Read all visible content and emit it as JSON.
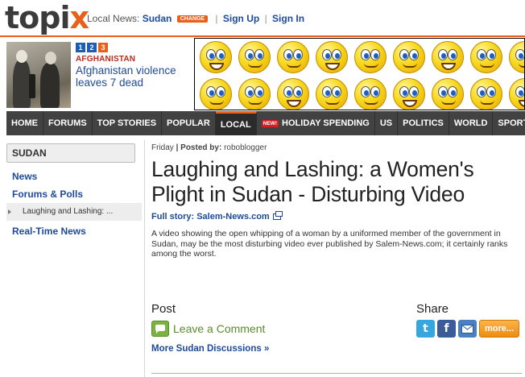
{
  "header": {
    "logo_text": "topi",
    "logo_x": "x",
    "local_news_label": "Local News:",
    "city": "Sudan",
    "change_badge": "CHANGE",
    "sign_up": "Sign Up",
    "sign_in": "Sign In",
    "separator": "|"
  },
  "featured": {
    "pages": [
      "1",
      "2",
      "3"
    ],
    "category": "AFGHANISTAN",
    "title": "Afghanistan violence leaves 7 dead"
  },
  "nav": {
    "items": [
      {
        "label": "HOME"
      },
      {
        "label": "FORUMS"
      },
      {
        "label": "TOP STORIES"
      },
      {
        "label": "POPULAR"
      },
      {
        "label": "LOCAL"
      },
      {
        "label": "HOLIDAY SPENDING"
      },
      {
        "label": "US"
      },
      {
        "label": "POLITICS"
      },
      {
        "label": "WORLD"
      },
      {
        "label": "SPORTS"
      }
    ],
    "new_badge": "NEW!",
    "active": "LOCAL"
  },
  "sidebar": {
    "heading": "SUDAN",
    "links": [
      "News",
      "Forums & Polls"
    ],
    "current_item": "Laughing and Lashing: ...",
    "realtime": "Real-Time News"
  },
  "article": {
    "day": "Friday",
    "posted_by_label": "Posted by:",
    "author": "roboblogger",
    "title": "Laughing and Lashing: a Women's Plight in Sudan - Disturbing Video",
    "full_story": "Full story: Salem-News.com",
    "summary": "A video showing the open whipping of a woman by a uniformed member of the government in Sudan, may be the most disturbing video ever published by Salem-News.com; it certainly ranks among the worst."
  },
  "post": {
    "label": "Post",
    "leave_comment": "Leave a Comment",
    "more_discussions": "More Sudan Discussions »"
  },
  "share": {
    "label": "Share",
    "twitter": "t",
    "facebook": "f",
    "more": "more..."
  },
  "colors": {
    "accent_orange": "#e8601c",
    "link_blue": "#1d4a9a",
    "nav_bg": "#424242",
    "comment_green": "#5a8b2c"
  }
}
